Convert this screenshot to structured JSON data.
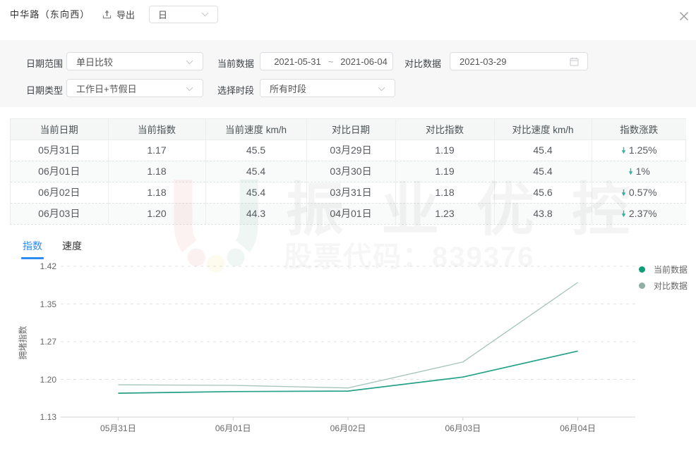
{
  "header": {
    "title": "中华路（东向西）",
    "export_label": "导出",
    "period_value": "日"
  },
  "filters": {
    "date_range": {
      "label": "日期范围",
      "value": "单日比较"
    },
    "current_data": {
      "label": "当前数据",
      "start": "2021-05-31",
      "separator": "~",
      "end": "2021-06-04"
    },
    "compare_data": {
      "label": "对比数据",
      "value": "2021-03-29"
    },
    "date_type": {
      "label": "日期类型",
      "value": "工作日+节假日"
    },
    "time_period": {
      "label": "选择时段",
      "value": "所有时段"
    }
  },
  "table": {
    "columns": [
      "当前日期",
      "当前指数",
      "当前速度 km/h",
      "对比日期",
      "对比指数",
      "对比速度 km/h",
      "指数涨跌"
    ],
    "rows": [
      {
        "cells": [
          "05月31日",
          "1.17",
          "45.5",
          "03月29日",
          "1.19",
          "45.4"
        ],
        "change": "1.25%",
        "direction": "down"
      },
      {
        "cells": [
          "06月01日",
          "1.18",
          "45.4",
          "03月30日",
          "1.19",
          "45.4"
        ],
        "change": "1%",
        "direction": "down"
      },
      {
        "cells": [
          "06月02日",
          "1.18",
          "45.4",
          "03月31日",
          "1.18",
          "45.6"
        ],
        "change": "0.57%",
        "direction": "down"
      },
      {
        "cells": [
          "06月03日",
          "1.20",
          "44.3",
          "04月01日",
          "1.23",
          "43.8"
        ],
        "change": "2.37%",
        "direction": "down"
      }
    ]
  },
  "tabs": [
    {
      "label": "指数",
      "active": true
    },
    {
      "label": "速度",
      "active": false
    }
  ],
  "watermark": {
    "brand": "振业优控",
    "stock_line": "股票代码：839376"
  },
  "chart_data": {
    "type": "line",
    "title": "",
    "ylabel": "拥堵指数",
    "categories": [
      "05月31日",
      "06月01日",
      "06月02日",
      "06月03日",
      "06月04日"
    ],
    "series": [
      {
        "name": "当前数据",
        "color": "#0f9d78",
        "line_color": "#23a287",
        "line_width": 1.7,
        "values": [
          1.176,
          1.179,
          1.18,
          1.207,
          1.257
        ]
      },
      {
        "name": "对比数据",
        "color": "#8fafa6",
        "line_color": "#a5c3ba",
        "line_width": 1.3,
        "values": [
          1.192,
          1.191,
          1.186,
          1.236,
          1.389
        ]
      }
    ],
    "ylim": [
      1.13,
      1.42
    ],
    "yticks": [
      "1.13",
      "1.20",
      "1.27",
      "1.35",
      "1.42"
    ],
    "grid": "dashed horizontal",
    "legend_position": "right"
  }
}
